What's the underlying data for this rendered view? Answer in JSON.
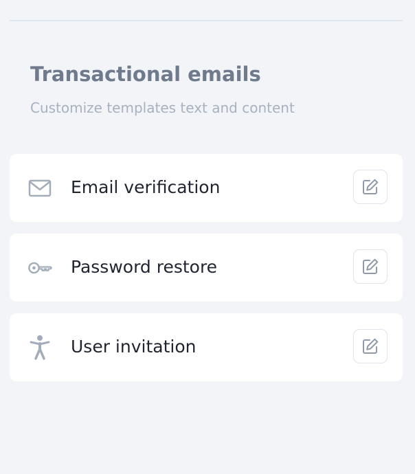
{
  "section": {
    "title": "Transactional emails",
    "subtitle": "Customize templates text and content"
  },
  "templates": [
    {
      "label": "Email verification",
      "icon": "envelope-icon"
    },
    {
      "label": "Password restore",
      "icon": "key-icon"
    },
    {
      "label": "User invitation",
      "icon": "person-icon"
    }
  ],
  "colors": {
    "background": "#f2f4f8",
    "card": "#ffffff",
    "title": "#6f7a8c",
    "subtitle": "#a8b1bf",
    "icon": "#a3acba",
    "text": "#1f2430"
  }
}
